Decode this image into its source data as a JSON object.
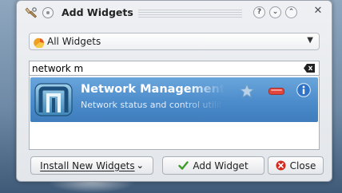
{
  "window": {
    "title": "Add Widgets",
    "titlebar_buttons": [
      {
        "name": "help",
        "glyph": "?"
      },
      {
        "name": "minimize",
        "glyph": "⌄"
      },
      {
        "name": "maximize",
        "glyph": "⌃"
      }
    ],
    "close_glyph": "✕"
  },
  "filter": {
    "selected": "All Widgets",
    "icon": "widget-category-icon"
  },
  "search": {
    "value": "network m",
    "clear_icon": "clear-text-icon"
  },
  "widgets": [
    {
      "name": "Network Management",
      "description": "Network status and control utility",
      "icon": "network-management-icon",
      "selected": true
    }
  ],
  "footer": {
    "install_label": "Install New Widgets",
    "install_arrow": "⌄",
    "add_label": "Add Widget",
    "close_label": "Close"
  },
  "colors": {
    "selection": "#4c8ccb",
    "accent_check": "#3f9a2c",
    "close_red": "#d52a1e",
    "info_blue": "#2f74c9"
  }
}
